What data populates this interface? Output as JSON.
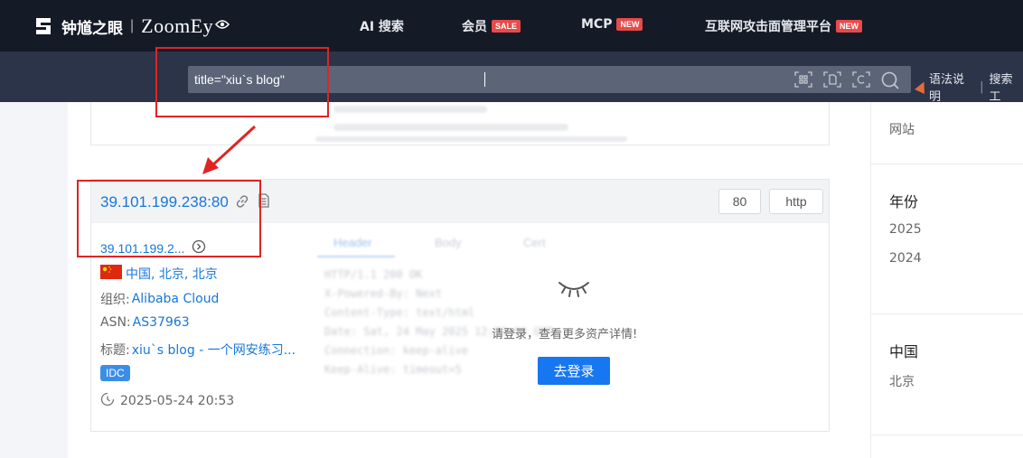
{
  "brand": {
    "name_cn": "钟馗之眼",
    "name_en": "ZoomEy"
  },
  "nav": [
    {
      "label": "AI 搜索",
      "badge": ""
    },
    {
      "label": "会员",
      "badge": "SALE"
    },
    {
      "label": "MCP",
      "badge": "NEW"
    },
    {
      "label": "互联网攻击面管理平台",
      "badge": "NEW"
    }
  ],
  "search": {
    "query": "title=\"xiu`s blog\"",
    "syntax_label": "语法说明",
    "search_tools_label": "搜索工"
  },
  "result": {
    "ip_port": "39.101.199.238:80",
    "ports": [
      "80",
      "http"
    ],
    "ip_short": "39.101.199.2...",
    "location": "中国, 北京, 北京",
    "org_label": "组织:",
    "org": "Alibaba Cloud",
    "asn_label": "ASN:",
    "asn": "AS37963",
    "title_label": "标题:",
    "title": "xiu`s blog - 一个网安练习...",
    "tag": "IDC",
    "time": "2025-05-24 20:53",
    "tabs": [
      "Header",
      "Body",
      "Cert"
    ],
    "blurred_header": [
      "HTTP/1.1 200 OK",
      "X-Powered-By: Next",
      "Content-Type: text/html",
      "Date: Sat, 24 May 2025 12:53:00 GMT",
      "Connection: keep-alive",
      "Keep-Alive: timeout=5"
    ],
    "login_msg": "请登录，查看更多资产详情!",
    "login_btn": "去登录"
  },
  "sidebar": {
    "top_item": "网站",
    "year_title": "年份",
    "years": [
      "2025",
      "2024"
    ],
    "country_title": "中国",
    "cities": [
      "北京"
    ]
  },
  "colors": {
    "accent": "#1677d9",
    "annotation": "#e02424",
    "nav_bg": "#141a26"
  }
}
